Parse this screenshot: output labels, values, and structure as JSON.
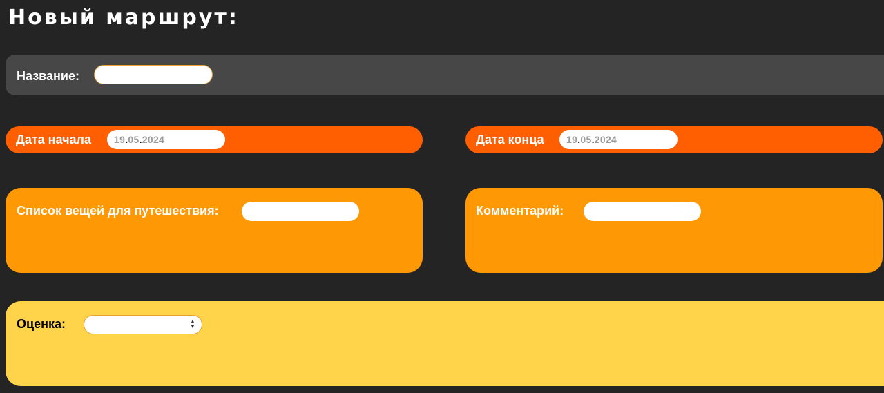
{
  "page": {
    "title": "Новый маршрут:"
  },
  "name_section": {
    "label": "Название:",
    "value": ""
  },
  "start_date": {
    "label": "Дата начала",
    "day": "19",
    "month": "05",
    "year": "2024",
    "separator": "."
  },
  "end_date": {
    "label": "Дата конца",
    "day": "19",
    "month": "05",
    "year": "2024",
    "separator": "."
  },
  "packing_list": {
    "label": "Список вещей для путешествия:",
    "value": ""
  },
  "comment": {
    "label": "Комментарий:",
    "value": ""
  },
  "rating": {
    "label": "Оценка:",
    "selected": ""
  },
  "colors": {
    "background": "#242424",
    "name_panel": "#474747",
    "date_panel": "#ff5f00",
    "text_panel": "#ff9805",
    "rating_panel": "#ffd44a",
    "input_border": "#e8a030"
  }
}
